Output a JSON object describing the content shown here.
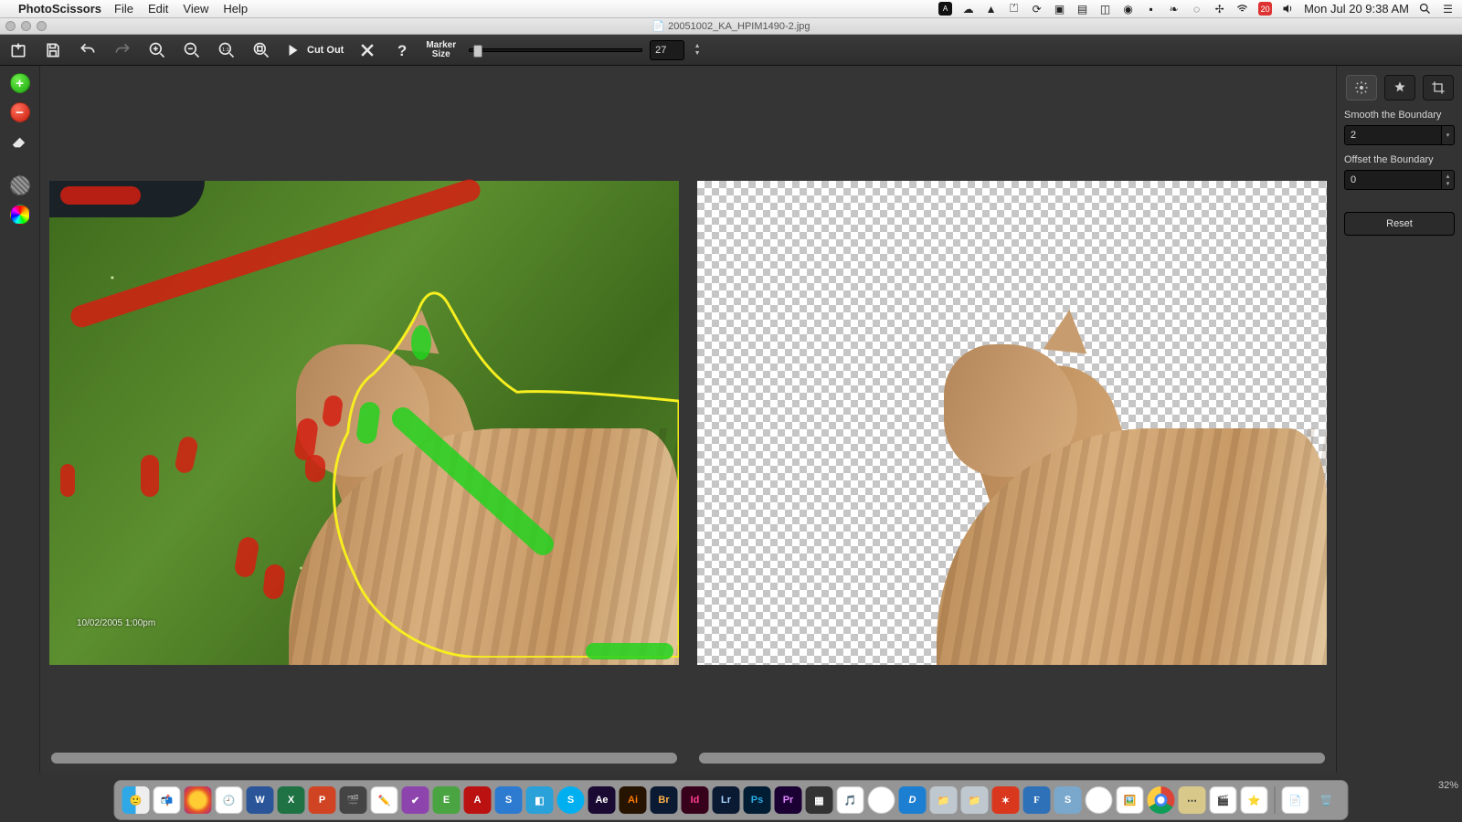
{
  "menubar": {
    "app_name": "PhotoScissors",
    "items": [
      "File",
      "Edit",
      "View",
      "Help"
    ],
    "clock": "Mon Jul 20  9:38 AM"
  },
  "window": {
    "filename": "20051002_KA_HPIM1490-2.jpg"
  },
  "toolbar": {
    "cutout_label": "Cut Out",
    "marker_label_1": "Marker",
    "marker_label_2": "Size",
    "marker_value": "27"
  },
  "right_panel": {
    "smooth_label": "Smooth the Boundary",
    "smooth_value": "2",
    "offset_label": "Offset the Boundary",
    "offset_value": "0",
    "reset_label": "Reset"
  },
  "canvas": {
    "timestamp": "10/02/2005 1:00pm",
    "zoom": "32%"
  },
  "colors": {
    "fg_green": "#22d21e",
    "bg_red": "#d31f12",
    "outline": "#f7ef1f"
  }
}
